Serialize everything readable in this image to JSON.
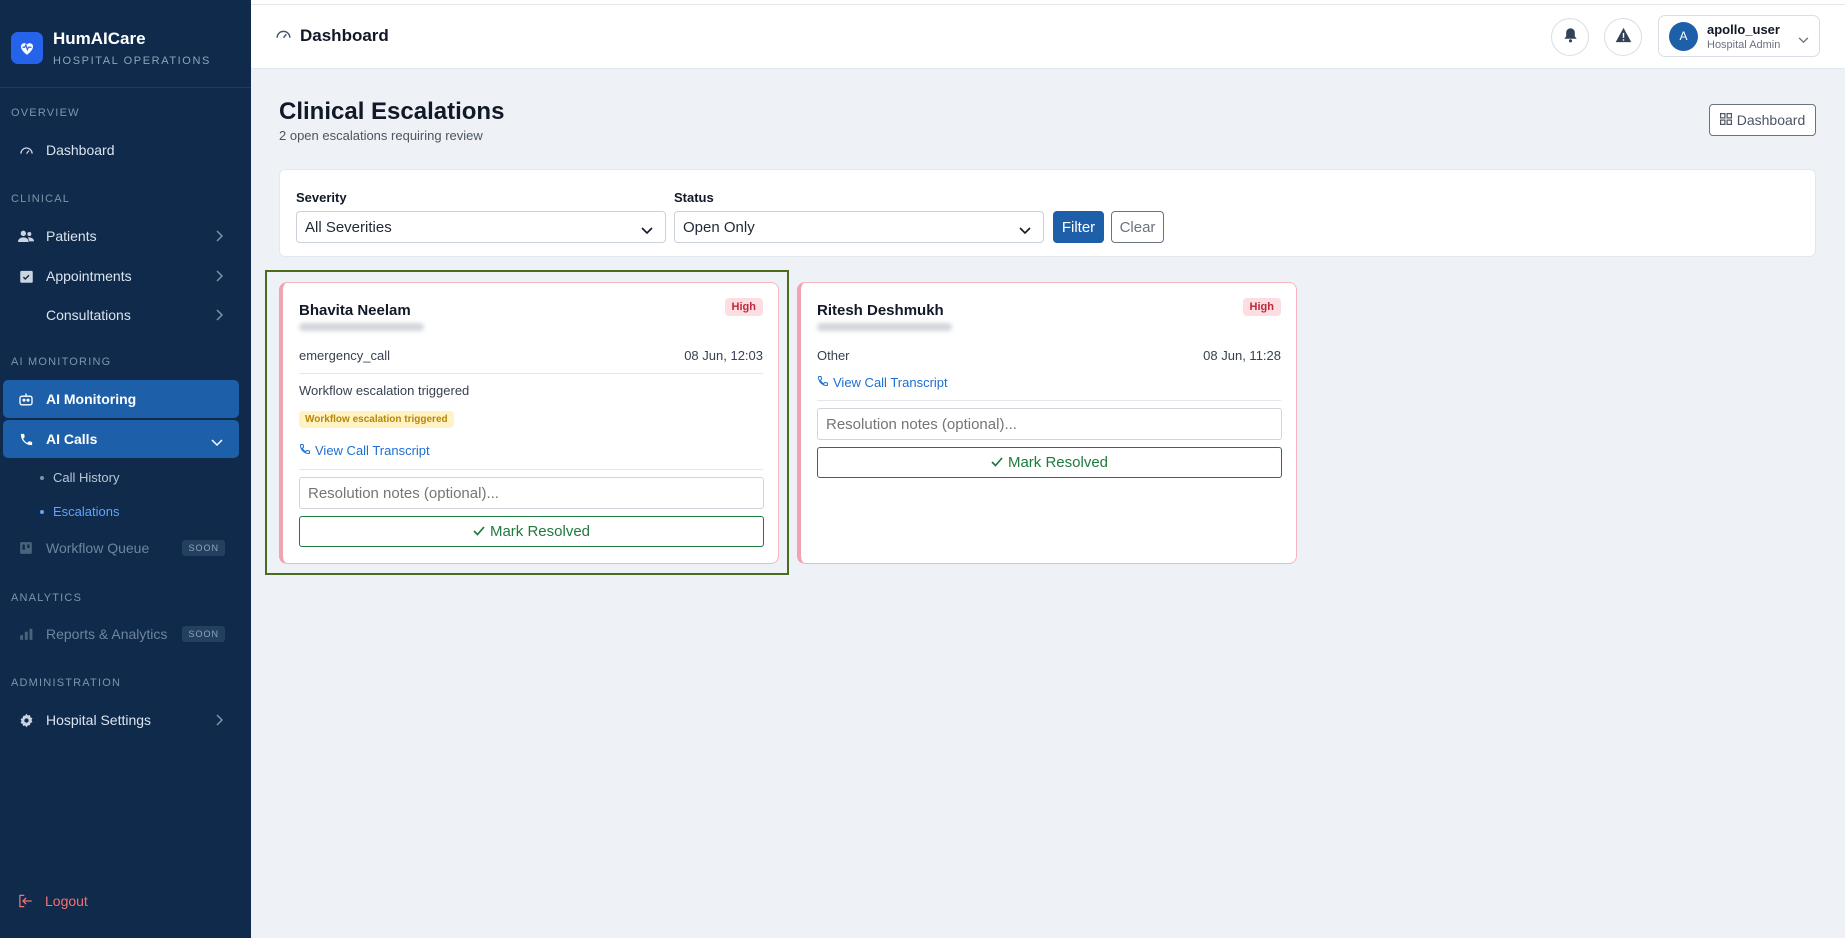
{
  "brand": {
    "name": "HumAICare",
    "subtitle": "HOSPITAL OPERATIONS"
  },
  "sidebar": {
    "sections": {
      "overview": "OVERVIEW",
      "clinical": "CLINICAL",
      "ai_monitoring": "AI MONITORING",
      "analytics": "ANALYTICS",
      "administration": "ADMINISTRATION"
    },
    "items": {
      "dashboard": "Dashboard",
      "patients": "Patients",
      "appointments": "Appointments",
      "consultations": "Consultations",
      "ai_monitoring": "AI Monitoring",
      "ai_calls": "AI Calls",
      "call_history": "Call History",
      "escalations": "Escalations",
      "workflow_queue": "Workflow Queue",
      "reports": "Reports & Analytics",
      "hospital_settings": "Hospital Settings"
    },
    "soon_badge": "SOON",
    "logout": "Logout"
  },
  "header": {
    "title": "Dashboard",
    "user": {
      "initial": "A",
      "name": "apollo_user",
      "role": "Hospital Admin"
    }
  },
  "main": {
    "title": "Clinical Escalations",
    "subtitle": "2 open escalations requiring review",
    "dashboard_button": "Dashboard",
    "filters": {
      "severity_label": "Severity",
      "severity_value": "All Severities",
      "status_label": "Status",
      "status_value": "Open Only",
      "filter_button": "Filter",
      "clear_button": "Clear"
    },
    "escalations": [
      {
        "patient": "Bhavita Neelam",
        "severity": "High",
        "type": "emergency_call",
        "time": "08 Jun, 12:03",
        "reason": "Workflow escalation triggered",
        "tag": "Workflow escalation triggered",
        "transcript_link": "View Call Transcript",
        "notes_placeholder": "Resolution notes (optional)...",
        "resolve_label": "Mark Resolved"
      },
      {
        "patient": "Ritesh Deshmukh",
        "severity": "High",
        "type": "Other",
        "time": "08 Jun, 11:28",
        "transcript_link": "View Call Transcript",
        "notes_placeholder": "Resolution notes (optional)...",
        "resolve_label": "Mark Resolved"
      }
    ]
  },
  "colors": {
    "sidebar_bg": "#0f2a4a",
    "accent": "#1d5fa8",
    "high_badge_text": "#c0283b",
    "resolve_green": "#1e7a3e",
    "link_blue": "#1d6fd1"
  }
}
